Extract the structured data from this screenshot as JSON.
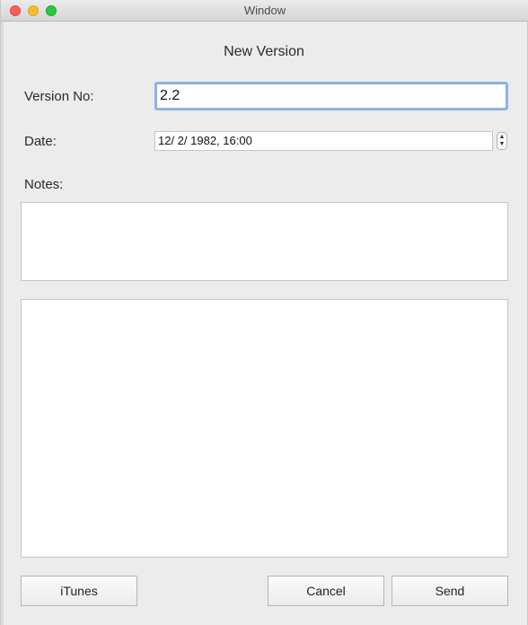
{
  "window": {
    "title": "Window"
  },
  "dialog": {
    "heading": "New Version"
  },
  "form": {
    "version_label": "Version No:",
    "version_value": "2.2",
    "date_label": "Date:",
    "date_value": "12/  2/ 1982,  16:00",
    "notes_label": "Notes:",
    "notes_value": "",
    "details_value": ""
  },
  "buttons": {
    "itunes": "iTunes",
    "cancel": "Cancel",
    "send": "Send"
  },
  "icons": {
    "stepper_up": "▲",
    "stepper_down": "▼"
  },
  "colors": {
    "close": "#fc5f57",
    "minimize": "#fdbc2e",
    "maximize": "#28c840",
    "focus_ring": "#8bb3e6"
  }
}
